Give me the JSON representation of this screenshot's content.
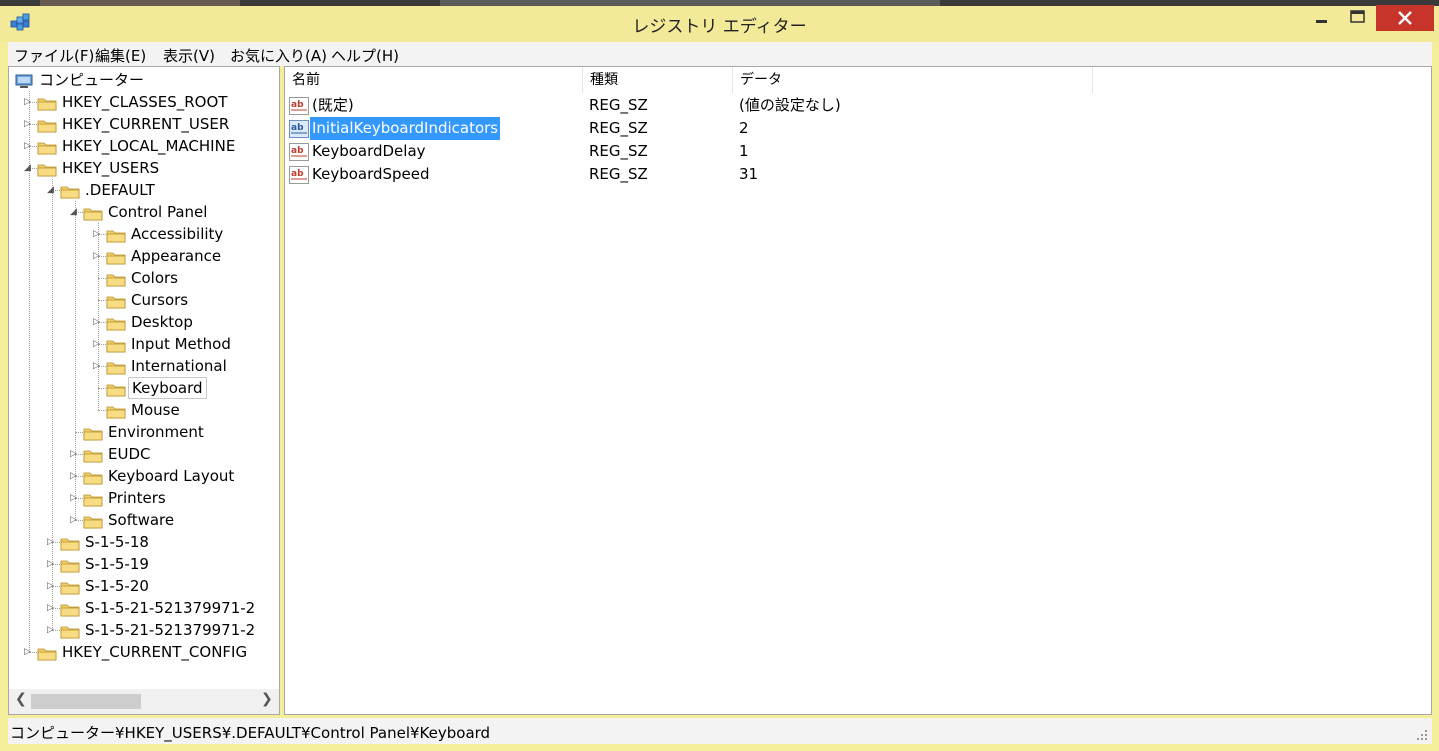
{
  "window": {
    "title": "レジストリ エディター",
    "icon": "regedit-icon"
  },
  "menu": [
    "ファイル(F)",
    "編集(E)",
    "表示(V)",
    "お気に入り(A)",
    "ヘルプ(H)"
  ],
  "tree": [
    {
      "label": "コンピューター",
      "expander": "expanded",
      "icon": "computer-icon"
    },
    {
      "label": "HKEY_CLASSES_ROOT",
      "expander": "collapsed"
    },
    {
      "label": "HKEY_CURRENT_USER",
      "expander": "collapsed"
    },
    {
      "label": "HKEY_LOCAL_MACHINE",
      "expander": "collapsed"
    },
    {
      "label": "HKEY_USERS",
      "expander": "expanded"
    },
    {
      "label": ".DEFAULT",
      "expander": "expanded"
    },
    {
      "label": "Control Panel",
      "expander": "expanded"
    },
    {
      "label": "Accessibility",
      "expander": "collapsed"
    },
    {
      "label": "Appearance",
      "expander": "collapsed"
    },
    {
      "label": "Colors",
      "expander": "none"
    },
    {
      "label": "Cursors",
      "expander": "none"
    },
    {
      "label": "Desktop",
      "expander": "collapsed"
    },
    {
      "label": "Input Method",
      "expander": "collapsed"
    },
    {
      "label": "International",
      "expander": "collapsed"
    },
    {
      "label": "Keyboard",
      "expander": "none",
      "selected": true
    },
    {
      "label": "Mouse",
      "expander": "none"
    },
    {
      "label": "Environment",
      "expander": "none"
    },
    {
      "label": "EUDC",
      "expander": "collapsed"
    },
    {
      "label": "Keyboard Layout",
      "expander": "collapsed"
    },
    {
      "label": "Printers",
      "expander": "collapsed"
    },
    {
      "label": "Software",
      "expander": "collapsed"
    },
    {
      "label": "S-1-5-18",
      "expander": "collapsed"
    },
    {
      "label": "S-1-5-19",
      "expander": "collapsed"
    },
    {
      "label": "S-1-5-20",
      "expander": "collapsed"
    },
    {
      "label": "S-1-5-21-521379971-2",
      "expander": "collapsed"
    },
    {
      "label": "S-1-5-21-521379971-2",
      "expander": "collapsed"
    },
    {
      "label": "HKEY_CURRENT_CONFIG",
      "expander": "collapsed"
    }
  ],
  "columns": {
    "name": "名前",
    "type": "種類",
    "data": "データ"
  },
  "values": [
    {
      "name": "(既定)",
      "type": "REG_SZ",
      "data": "(値の設定なし)",
      "icon": "string-value-icon"
    },
    {
      "name": "InitialKeyboardIndicators",
      "type": "REG_SZ",
      "data": "2",
      "icon": "string-value-icon",
      "selected": true
    },
    {
      "name": "KeyboardDelay",
      "type": "REG_SZ",
      "data": "1",
      "icon": "string-value-icon"
    },
    {
      "name": "KeyboardSpeed",
      "type": "REG_SZ",
      "data": "31",
      "icon": "string-value-icon"
    }
  ],
  "status": {
    "path": "コンピューター¥HKEY_USERS¥.DEFAULT¥Control Panel¥Keyboard"
  },
  "colors": {
    "title_bar": "#f2ea98",
    "selection": "#3399ff",
    "close_button": "#c7352a",
    "folder": "#e8c25a"
  }
}
